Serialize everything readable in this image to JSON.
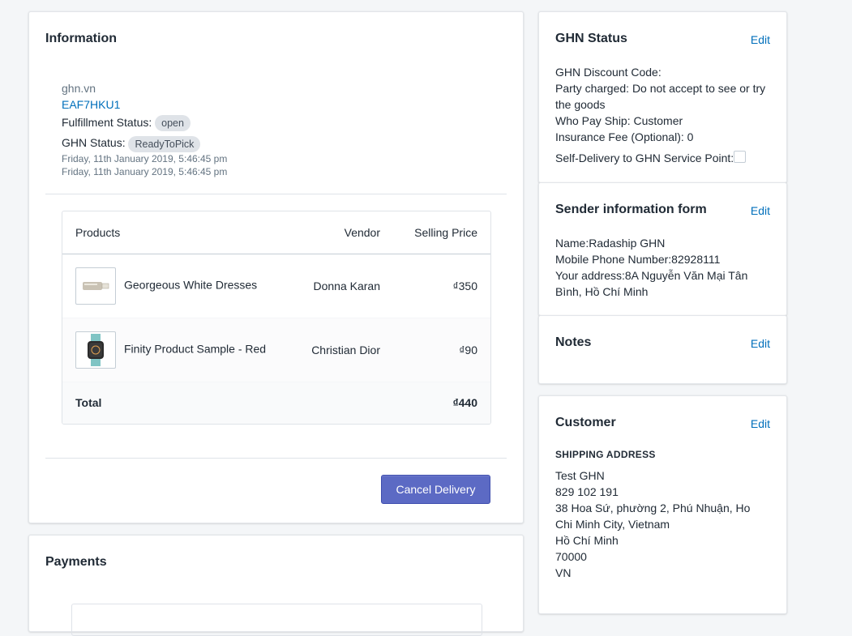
{
  "info": {
    "title": "Information",
    "carrier_site": "ghn.vn",
    "tracking_code": "EAF7HKU1",
    "fulfillment_label": "Fulfillment Status:",
    "fulfillment_status": "open",
    "ghn_label": "GHN Status:",
    "ghn_status": "ReadyToPick",
    "date1": "Friday, 11th January 2019, 5:46:45 pm",
    "date2": "Friday, 11th January 2019, 5:46:45 pm",
    "table": {
      "headers": [
        "Products",
        "Vendor",
        "Selling Price"
      ],
      "rows": [
        {
          "product": "Georgeous White Dresses",
          "vendor": "Donna Karan",
          "price": "₫350",
          "thumb": "usb-drive-icon"
        },
        {
          "product": "Finity Product Sample - Red",
          "vendor": "Christian Dior",
          "price": "₫90",
          "thumb": "smartwatch-icon"
        }
      ],
      "total_label": "Total",
      "total_value": "₫440"
    },
    "cancel_label": "Cancel Delivery"
  },
  "payments": {
    "title": "Payments"
  },
  "ghn": {
    "title": "GHN Status",
    "edit": "Edit",
    "discount": "GHN Discount Code:",
    "party": "Party charged: Do not accept to see or try the goods",
    "who_pay": "Who Pay Ship: Customer",
    "insurance": "Insurance Fee (Optional): 0",
    "self_delivery": "Self-Delivery to GHN Service Point:"
  },
  "sender": {
    "title": "Sender information form",
    "edit": "Edit",
    "name": "Name:Radaship GHN",
    "phone": "Mobile Phone Number:82928111",
    "address": "Your address:8A Nguyễn Văn Mại Tân Bình, Hồ Chí Minh"
  },
  "notes": {
    "title": "Notes",
    "edit": "Edit"
  },
  "customer": {
    "title": "Customer",
    "edit": "Edit",
    "shipping_heading": "SHIPPING ADDRESS",
    "lines": [
      "Test GHN",
      "829 102 191",
      "38 Hoa Sứ, phường 2, Phú Nhuận, Ho Chi Minh City, Vietnam",
      "Hồ Chí Minh",
      "70000",
      "VN"
    ]
  },
  "colors": {
    "accent": "#5c6ac4",
    "link": "#006fbb",
    "badge_bg": "#dfe3e8"
  }
}
